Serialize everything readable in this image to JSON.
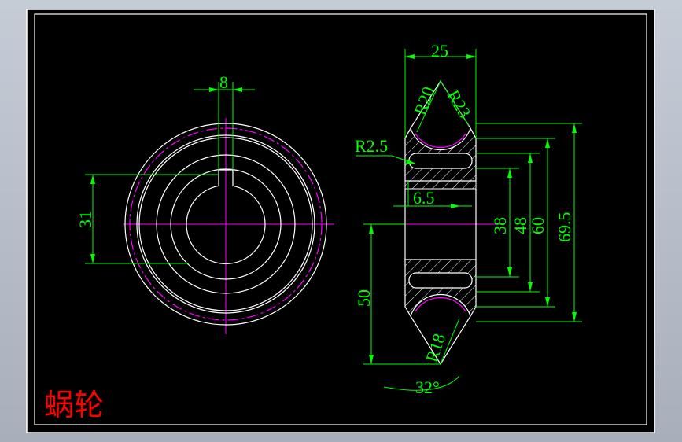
{
  "drawing": {
    "title": "蜗轮",
    "colors": {
      "background": "#000000",
      "outline": "#ffffff",
      "dimension": "#00ff00",
      "centerline": "#ff00ff",
      "hatch": "#ffffff",
      "title": "#ff0000",
      "frame": "#ffffff"
    },
    "dimensions": {
      "key_width": "8",
      "key_height": "31",
      "total_width": "25",
      "r20": "R20",
      "r23": "R23",
      "r25": "R2.5",
      "d65": "6.5",
      "d38": "38",
      "d48": "48",
      "d60": "60",
      "d695": "69.5",
      "d50": "50",
      "r18": "R18",
      "angle": "32°"
    }
  }
}
